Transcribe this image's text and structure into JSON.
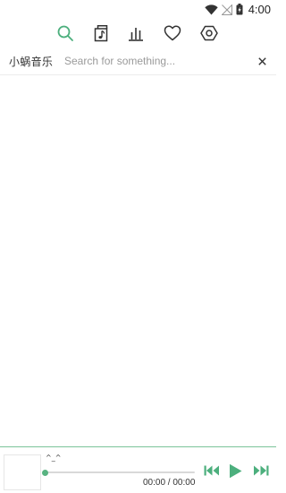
{
  "status_bar": {
    "time": "4:00",
    "icons": [
      "wifi-icon",
      "no-signal-icon",
      "battery-charging-icon"
    ]
  },
  "tabs": [
    {
      "name": "search",
      "icon": "search-icon",
      "active": true
    },
    {
      "name": "music-library",
      "icon": "music-file-icon",
      "active": false
    },
    {
      "name": "charts",
      "icon": "bar-chart-icon",
      "active": false
    },
    {
      "name": "favorites",
      "icon": "heart-icon",
      "active": false
    },
    {
      "name": "settings",
      "icon": "hexagon-settings-icon",
      "active": false
    }
  ],
  "search": {
    "app_name": "小蜗音乐",
    "placeholder": "Search for something...",
    "value": "",
    "clear_icon": "close-icon"
  },
  "player": {
    "title": "^_^",
    "time": "00:00 / 00:00",
    "progress": 0,
    "controls": [
      "previous-icon",
      "play-icon",
      "next-icon"
    ]
  },
  "colors": {
    "accent": "#4caf7d",
    "icon": "#333333",
    "placeholder": "#9a9a9a",
    "divider": "#7cc49a"
  }
}
